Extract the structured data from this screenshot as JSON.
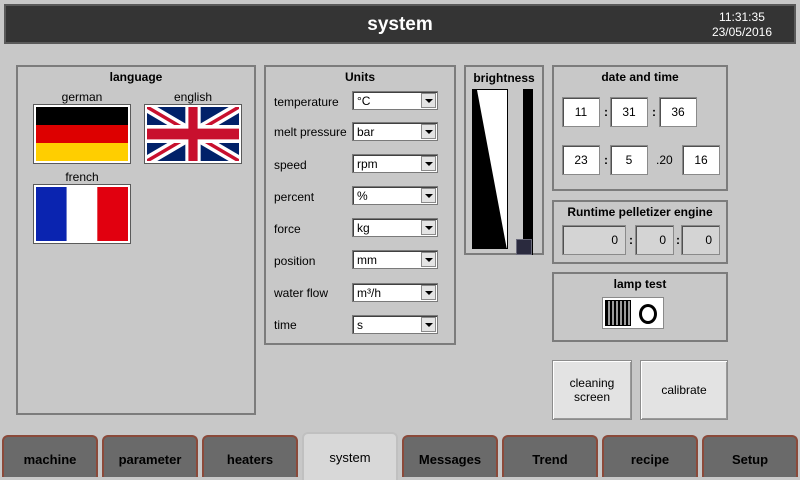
{
  "header": {
    "title": "system",
    "time": "11:31:35",
    "date": "23/05/2016"
  },
  "language": {
    "title": "language",
    "flags": [
      {
        "label": "german"
      },
      {
        "label": "english"
      },
      {
        "label": "french"
      }
    ]
  },
  "units": {
    "title": "Units",
    "rows": [
      {
        "label": "temperature",
        "value": "°C"
      },
      {
        "label": "melt pressure",
        "value": "bar"
      },
      {
        "label": "speed",
        "value": "rpm"
      },
      {
        "label": "percent",
        "value": "%"
      },
      {
        "label": "force",
        "value": "kg"
      },
      {
        "label": "position",
        "value": "mm"
      },
      {
        "label": "water flow",
        "value": "m³/h"
      },
      {
        "label": "time",
        "value": "s"
      }
    ]
  },
  "brightness": {
    "title": "brightness",
    "level": 0.0
  },
  "datetime": {
    "title": "date and time",
    "hour": "11",
    "minute": "31",
    "second": "36",
    "day": "23",
    "month": "5",
    "year_prefix": ".20",
    "year": "16"
  },
  "runtime": {
    "title": "Runtime pelletizer engine",
    "hours": "0",
    "minutes": "0",
    "seconds": "0"
  },
  "lamp_test": {
    "title": "lamp test"
  },
  "buttons": {
    "cleaning_screen": "cleaning screen",
    "calibrate": "calibrate"
  },
  "tabs": [
    {
      "label": "machine"
    },
    {
      "label": "parameter"
    },
    {
      "label": "heaters"
    },
    {
      "label": "system",
      "active": true
    },
    {
      "label": "Messages"
    },
    {
      "label": "Trend"
    },
    {
      "label": "recipe"
    },
    {
      "label": "Setup"
    }
  ],
  "colors": {
    "header_bg": "#343434",
    "panel_bg": "#c8c8c8",
    "tab_bg": "#6a6a6a"
  }
}
